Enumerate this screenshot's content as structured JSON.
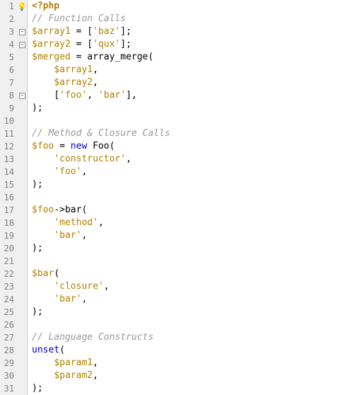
{
  "lines": [
    {
      "num": 1,
      "marker": "bulb",
      "tokens": [
        [
          "tag",
          "<?php"
        ]
      ]
    },
    {
      "num": 2,
      "tokens": [
        [
          "comment",
          "// Function Calls"
        ]
      ]
    },
    {
      "num": 3,
      "fold": "minus",
      "tokens": [
        [
          "var",
          "$array1"
        ],
        [
          "plain",
          " "
        ],
        [
          "op",
          "="
        ],
        [
          "plain",
          " "
        ],
        [
          "punct",
          "["
        ],
        [
          "string",
          "'baz'"
        ],
        [
          "punct",
          "];"
        ]
      ]
    },
    {
      "num": 4,
      "fold": "minus",
      "tokens": [
        [
          "var",
          "$array2"
        ],
        [
          "plain",
          " "
        ],
        [
          "op",
          "="
        ],
        [
          "plain",
          " "
        ],
        [
          "punct",
          "["
        ],
        [
          "string",
          "'qux'"
        ],
        [
          "punct",
          "];"
        ]
      ]
    },
    {
      "num": 5,
      "tokens": [
        [
          "var",
          "$merged"
        ],
        [
          "plain",
          " "
        ],
        [
          "op",
          "="
        ],
        [
          "plain",
          " "
        ],
        [
          "func",
          "array_merge"
        ],
        [
          "punct",
          "("
        ]
      ]
    },
    {
      "num": 6,
      "tokens": [
        [
          "plain",
          "    "
        ],
        [
          "var",
          "$array1"
        ],
        [
          "punct",
          ","
        ]
      ]
    },
    {
      "num": 7,
      "tokens": [
        [
          "plain",
          "    "
        ],
        [
          "var",
          "$array2"
        ],
        [
          "punct",
          ","
        ]
      ]
    },
    {
      "num": 8,
      "fold": "minus",
      "tokens": [
        [
          "plain",
          "    "
        ],
        [
          "punct",
          "["
        ],
        [
          "string",
          "'foo'"
        ],
        [
          "punct",
          ", "
        ],
        [
          "string",
          "'bar'"
        ],
        [
          "punct",
          "],"
        ]
      ]
    },
    {
      "num": 9,
      "tokens": [
        [
          "punct",
          ");"
        ]
      ]
    },
    {
      "num": 10,
      "tokens": []
    },
    {
      "num": 11,
      "tokens": [
        [
          "comment",
          "// Method & Closure Calls"
        ]
      ]
    },
    {
      "num": 12,
      "tokens": [
        [
          "var",
          "$foo"
        ],
        [
          "plain",
          " "
        ],
        [
          "op",
          "="
        ],
        [
          "plain",
          " "
        ],
        [
          "keyword",
          "new"
        ],
        [
          "plain",
          " "
        ],
        [
          "func",
          "Foo"
        ],
        [
          "punct",
          "("
        ]
      ]
    },
    {
      "num": 13,
      "tokens": [
        [
          "plain",
          "    "
        ],
        [
          "string",
          "'constructor'"
        ],
        [
          "punct",
          ","
        ]
      ]
    },
    {
      "num": 14,
      "tokens": [
        [
          "plain",
          "    "
        ],
        [
          "string",
          "'foo'"
        ],
        [
          "punct",
          ","
        ]
      ]
    },
    {
      "num": 15,
      "tokens": [
        [
          "punct",
          ");"
        ]
      ]
    },
    {
      "num": 16,
      "tokens": []
    },
    {
      "num": 17,
      "tokens": [
        [
          "var",
          "$foo"
        ],
        [
          "op",
          "->"
        ],
        [
          "func",
          "bar"
        ],
        [
          "punct",
          "("
        ]
      ]
    },
    {
      "num": 18,
      "tokens": [
        [
          "plain",
          "    "
        ],
        [
          "string",
          "'method'"
        ],
        [
          "punct",
          ","
        ]
      ]
    },
    {
      "num": 19,
      "tokens": [
        [
          "plain",
          "    "
        ],
        [
          "string",
          "'bar'"
        ],
        [
          "punct",
          ","
        ]
      ]
    },
    {
      "num": 20,
      "tokens": [
        [
          "punct",
          ");"
        ]
      ]
    },
    {
      "num": 21,
      "tokens": []
    },
    {
      "num": 22,
      "tokens": [
        [
          "var",
          "$bar"
        ],
        [
          "punct",
          "("
        ]
      ]
    },
    {
      "num": 23,
      "tokens": [
        [
          "plain",
          "    "
        ],
        [
          "string",
          "'closure'"
        ],
        [
          "punct",
          ","
        ]
      ]
    },
    {
      "num": 24,
      "tokens": [
        [
          "plain",
          "    "
        ],
        [
          "string",
          "'bar'"
        ],
        [
          "punct",
          ","
        ]
      ]
    },
    {
      "num": 25,
      "tokens": [
        [
          "punct",
          ");"
        ]
      ]
    },
    {
      "num": 26,
      "tokens": []
    },
    {
      "num": 27,
      "tokens": [
        [
          "comment",
          "// Language Constructs"
        ]
      ]
    },
    {
      "num": 28,
      "tokens": [
        [
          "keyword",
          "unset"
        ],
        [
          "punct",
          "("
        ]
      ]
    },
    {
      "num": 29,
      "tokens": [
        [
          "plain",
          "    "
        ],
        [
          "var",
          "$param1"
        ],
        [
          "punct",
          ","
        ]
      ]
    },
    {
      "num": 30,
      "tokens": [
        [
          "plain",
          "    "
        ],
        [
          "var",
          "$param2"
        ],
        [
          "punct",
          ","
        ]
      ]
    },
    {
      "num": 31,
      "tokens": [
        [
          "punct",
          ");"
        ]
      ]
    }
  ],
  "bulb_glyph": "💡",
  "fold_minus_glyph": "−"
}
